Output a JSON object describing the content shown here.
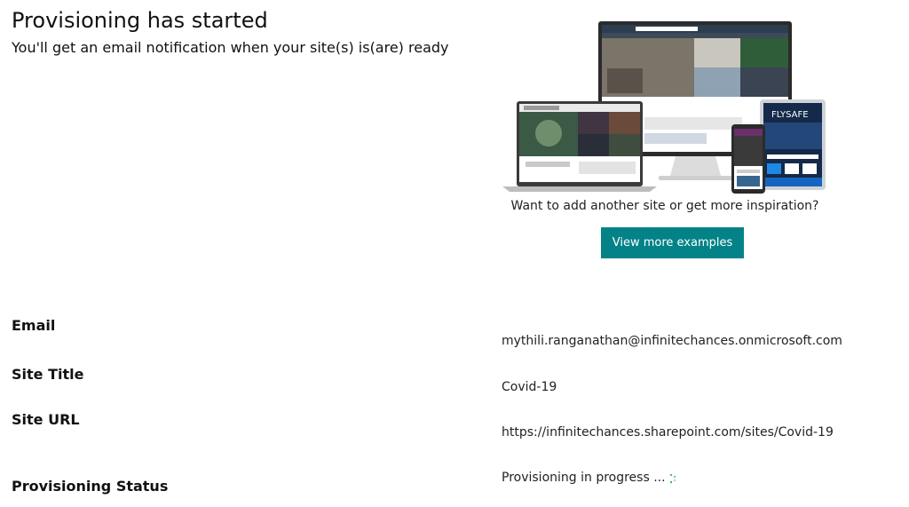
{
  "header": {
    "title": "Provisioning has started",
    "subtitle": "You'll get an email notification when your site(s) is(are) ready"
  },
  "inspiration": {
    "prompt": "Want to add another site or get more inspiration?",
    "button_label": "View more examples",
    "preview_brand_text": "FLYSAFE",
    "accent_color": "#038387"
  },
  "details": {
    "email_label": "Email",
    "email_value": "mythili.ranganathan@infinitechances.onmicrosoft.com",
    "site_title_label": "Site Title",
    "site_title_value": "Covid-19",
    "site_url_label": "Site URL",
    "site_url_value": "https://infinitechances.sharepoint.com/sites/Covid-19",
    "status_label": "Provisioning Status",
    "status_value": "Provisioning in progress ..."
  },
  "icons": {
    "status_spinner": "loading-spinner-icon"
  }
}
